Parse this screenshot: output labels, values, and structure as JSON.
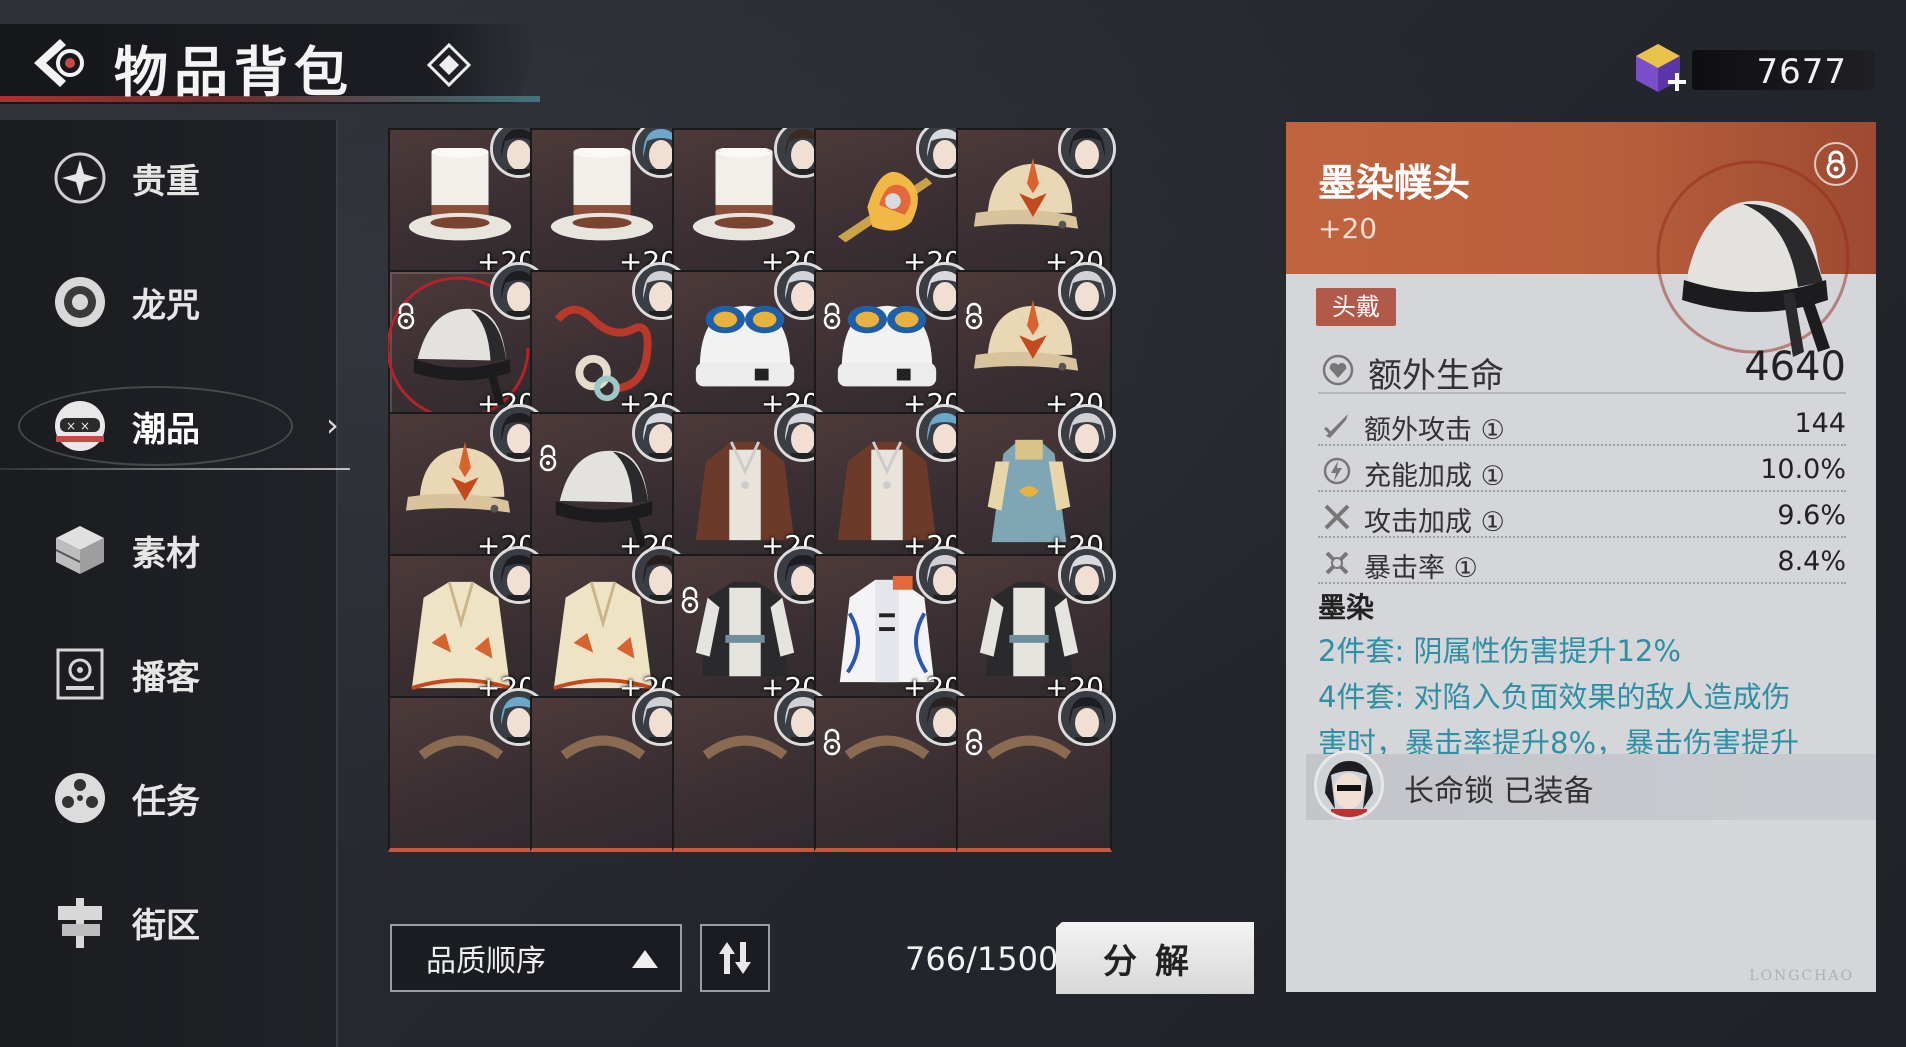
{
  "header": {
    "title": "物品背包"
  },
  "currency": {
    "value": "7677"
  },
  "sidebar": {
    "items": [
      {
        "label": "贵重",
        "icon": "star-sparkle-icon"
      },
      {
        "label": "龙咒",
        "icon": "vinyl-disc-icon"
      },
      {
        "label": "潮品",
        "icon": "mask-icon",
        "active": true
      },
      {
        "label": "素材",
        "icon": "crate-icon"
      },
      {
        "label": "播客",
        "icon": "speaker-icon"
      },
      {
        "label": "任务",
        "icon": "film-reel-icon"
      },
      {
        "label": "街区",
        "icon": "street-sign-icon"
      }
    ]
  },
  "grid": {
    "items": [
      {
        "type": "tophat",
        "level": "+20",
        "locked": false
      },
      {
        "type": "tophat",
        "level": "+20",
        "locked": false
      },
      {
        "type": "tophat",
        "level": "+20",
        "locked": false
      },
      {
        "type": "golden-ornament",
        "level": "+20",
        "locked": false
      },
      {
        "type": "cap",
        "level": "+20",
        "locked": false
      },
      {
        "type": "black-hat",
        "level": "+20",
        "locked": true,
        "selected": true
      },
      {
        "type": "red-cord",
        "level": "+20",
        "locked": false
      },
      {
        "type": "beanie",
        "level": "+20",
        "locked": false
      },
      {
        "type": "beanie",
        "level": "+20",
        "locked": true
      },
      {
        "type": "cap",
        "level": "+20",
        "locked": true
      },
      {
        "type": "cap",
        "level": "+20",
        "locked": false
      },
      {
        "type": "black-hat",
        "level": "+20",
        "locked": true
      },
      {
        "type": "brown-jacket",
        "level": "+20",
        "locked": false
      },
      {
        "type": "brown-jacket",
        "level": "+20",
        "locked": false
      },
      {
        "type": "blue-robe",
        "level": "+20",
        "locked": false
      },
      {
        "type": "cream-coat",
        "level": "+20",
        "locked": false
      },
      {
        "type": "cream-coat",
        "level": "+20",
        "locked": false
      },
      {
        "type": "black-jacket",
        "level": "+20",
        "locked": true
      },
      {
        "type": "white-jacket",
        "level": "+20",
        "locked": false
      },
      {
        "type": "black-jacket",
        "level": "+20",
        "locked": false
      },
      {
        "type": "partial",
        "level": "",
        "locked": false
      },
      {
        "type": "partial",
        "level": "",
        "locked": false
      },
      {
        "type": "partial",
        "level": "",
        "locked": false
      },
      {
        "type": "partial",
        "level": "",
        "locked": true
      },
      {
        "type": "partial",
        "level": "",
        "locked": true
      }
    ]
  },
  "footer": {
    "sort_label": "品质顺序",
    "capacity": "766/1500",
    "decompose_label": "分解"
  },
  "detail": {
    "name": "墨染幞头",
    "level": "+20",
    "tag": "头戴",
    "main_stat": {
      "label": "额外生命",
      "value": "4640"
    },
    "sub_stats": [
      {
        "label": "额外攻击 ①",
        "value": "144",
        "icon": "sword-icon"
      },
      {
        "label": "充能加成 ①",
        "value": "10.0%",
        "icon": "energy-icon"
      },
      {
        "label": "攻击加成 ①",
        "value": "9.6%",
        "icon": "crossed-swords-icon"
      },
      {
        "label": "暴击率 ①",
        "value": "8.4%",
        "icon": "crit-icon"
      }
    ],
    "set_name": "墨染",
    "set_effects": [
      "2件套: 阴属性伤害提升12%",
      "4件套: 对陷入负面效果的敌人造成伤",
      "害时，暴击率提升8%，暴击伤害提升"
    ],
    "equipped_text": "长命锁 已装备",
    "watermark": "LONGCHAO"
  },
  "colors": {
    "accent_orange": "#c0643f",
    "set_text": "#2f8fa3",
    "cell_border": "#c45a3b"
  }
}
